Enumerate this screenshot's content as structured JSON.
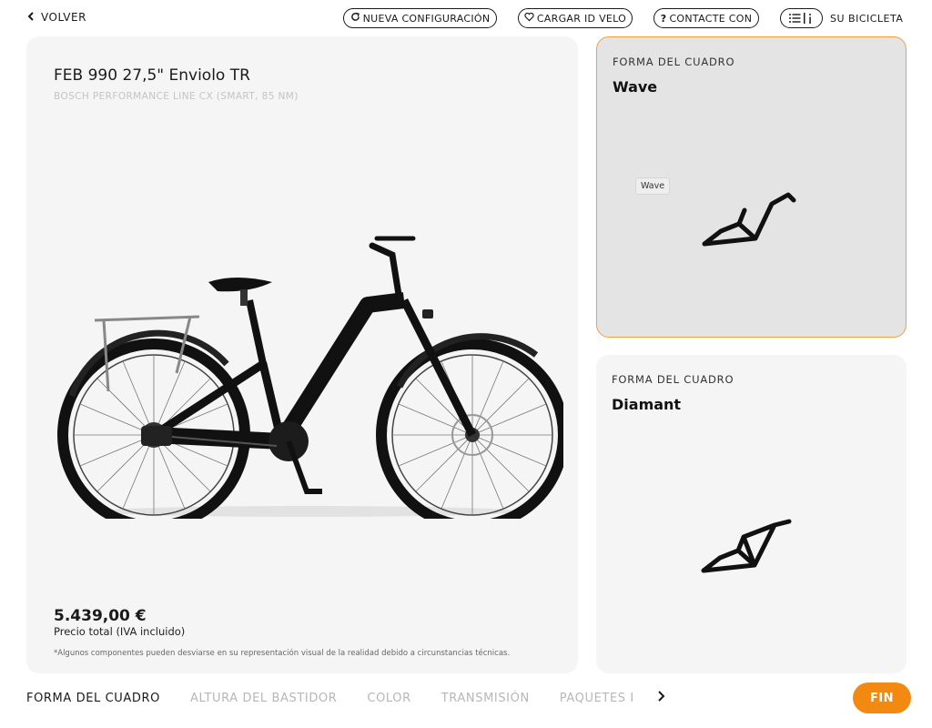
{
  "header": {
    "back_label": "VOLVER",
    "new_config_label": "NUEVA CONFIGURACIÓN",
    "load_id_label": "CARGAR ID VELO",
    "contact_label": "CONTACTE CON",
    "summary_label": "SU BICICLETA"
  },
  "preview": {
    "model_name": "FEB 990 27,5\" Enviolo TR",
    "motor": "BOSCH PERFORMANCE LINE CX (SMART, 85 NM)",
    "price": "5.439,00 €",
    "price_note": "Precio total (IVA incluido)",
    "disclaimer": "*Algunos componentes pueden desviarse en su representación visual de la realidad debido a circunstancias técnicas."
  },
  "options": [
    {
      "kicker": "FORMA DEL CUADRO",
      "name": "Wave",
      "selected": true,
      "tooltip": "Wave"
    },
    {
      "kicker": "FORMA DEL CUADRO",
      "name": "Diamant",
      "selected": false
    }
  ],
  "steps": [
    {
      "label": "FORMA DEL CUADRO",
      "active": true
    },
    {
      "label": "ALTURA DEL BASTIDOR",
      "active": false
    },
    {
      "label": "COLOR",
      "active": false
    },
    {
      "label": "TRANSMISIÓN",
      "active": false
    },
    {
      "label": "PAQUETES DE EQUIPAMIENTO",
      "active": false
    }
  ],
  "fin_label": "FIN",
  "colors": {
    "accent": "#f28a12",
    "selected_border": "#f5a13a",
    "card_bg": "#f5f5f5",
    "selected_bg": "#e4e4e4"
  },
  "icons": [
    "chevron-left-icon",
    "refresh-icon",
    "heart-icon",
    "question-icon",
    "summary-list-icon",
    "chevron-right-icon"
  ]
}
